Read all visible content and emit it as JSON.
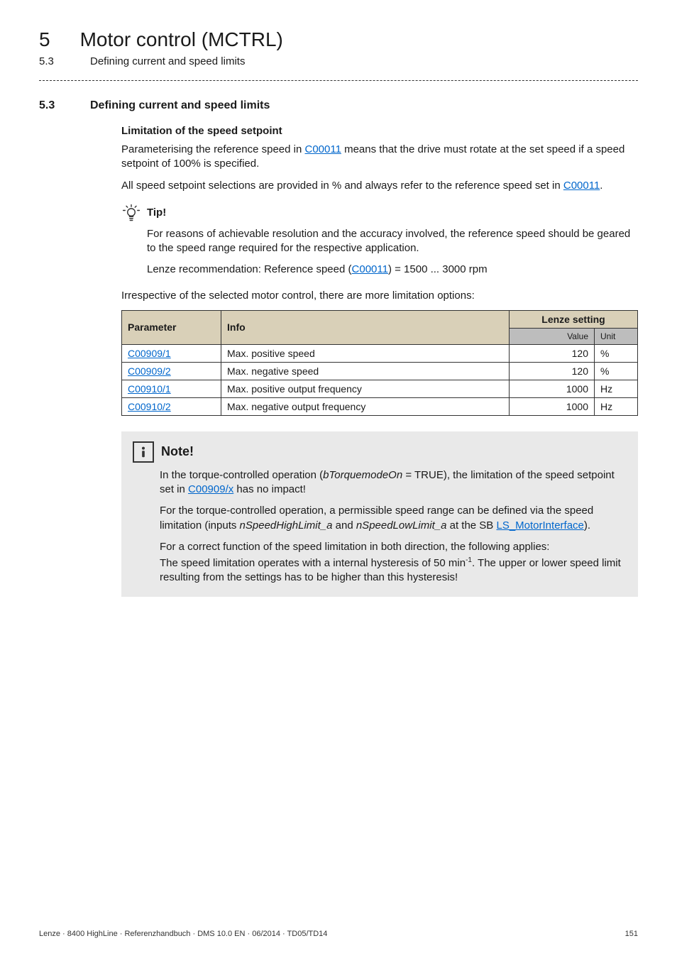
{
  "chapter": {
    "number": "5",
    "title": "Motor control (MCTRL)"
  },
  "subchapter": {
    "number": "5.3",
    "title": "Defining current and speed limits"
  },
  "section": {
    "number": "5.3",
    "title": "Defining current and speed limits",
    "subheading": "Limitation of the speed setpoint",
    "para1_a": "Parameterising the reference speed in ",
    "para1_link": "C00011",
    "para1_b": " means that the drive must rotate at the set speed if a speed setpoint of 100% is specified.",
    "para2_a": "All speed setpoint selections are provided in % and always refer to the reference speed set in ",
    "para2_link": "C00011",
    "para2_b": "."
  },
  "tip": {
    "label": "Tip!",
    "line1": "For reasons of achievable resolution and the accuracy involved, the reference speed should be geared to the speed range required for the respective application.",
    "line2_a": "Lenze recommendation: Reference speed (",
    "line2_link": "C00011",
    "line2_b": ") = 1500 ... 3000 rpm"
  },
  "table": {
    "intro": "Irrespective of the selected motor control, there are more limitation options:",
    "head_param": "Parameter",
    "head_info": "Info",
    "head_lenze": "Lenze setting",
    "head_value": "Value",
    "head_unit": "Unit",
    "rows": [
      {
        "param": "C00909/1",
        "info": "Max. positive speed",
        "value": "120",
        "unit": "%"
      },
      {
        "param": "C00909/2",
        "info": "Max. negative speed",
        "value": "120",
        "unit": "%"
      },
      {
        "param": "C00910/1",
        "info": "Max. positive output frequency",
        "value": "1000",
        "unit": "Hz"
      },
      {
        "param": "C00910/2",
        "info": "Max. negative output frequency",
        "value": "1000",
        "unit": "Hz"
      }
    ]
  },
  "note": {
    "label": "Note!",
    "p1_a": "In the torque-controlled operation (",
    "p1_var": "bTorquemodeOn",
    "p1_b": " = TRUE), the limitation of the speed setpoint set in ",
    "p1_link": "C00909/x",
    "p1_c": " has no impact!",
    "p2_a": "For the torque-controlled operation, a permissible speed range can be defined via the speed limitation (inputs ",
    "p2_var1": "nSpeedHighLimit_a",
    "p2_mid": " and ",
    "p2_var2": "nSpeedLowLimit_a",
    "p2_b": " at the SB ",
    "p2_link": "LS_MotorInterface",
    "p2_c": ").",
    "p3": "For a correct function of the speed limitation in both direction, the following applies:",
    "p4_a": "The speed limitation operates with a internal hysteresis of 50 min",
    "p4_sup": "-1",
    "p4_b": ". The upper or lower speed limit resulting from the settings has to be higher than this hysteresis!"
  },
  "footer": {
    "left": "Lenze · 8400 HighLine · Referenzhandbuch · DMS 10.0 EN · 06/2014 · TD05/TD14",
    "right": "151"
  }
}
